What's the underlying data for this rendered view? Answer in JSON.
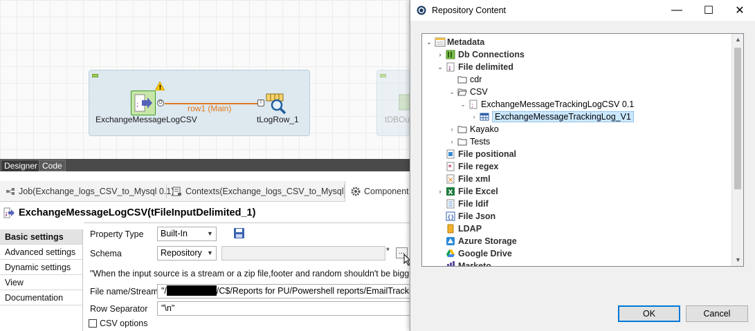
{
  "designer": {
    "nodes": {
      "input_label": "ExchangeMessageLogCSV",
      "output_label": "tLogRow_1",
      "faded_label": "tDBOu",
      "flow_label": "row1 (Main)"
    },
    "tabs": {
      "designer": "Designer",
      "code": "Code"
    }
  },
  "view_tabs": {
    "job": "Job(Exchange_logs_CSV_to_Mysql 0.1)",
    "contexts": "Contexts(Exchange_logs_CSV_to_Mysql)",
    "component": "Component"
  },
  "component_panel": {
    "title": "ExchangeMessageLogCSV(tFileInputDelimited_1)",
    "nav": [
      "Basic settings",
      "Advanced settings",
      "Dynamic settings",
      "View",
      "Documentation"
    ],
    "property_type": {
      "label": "Property Type",
      "value": "Built-In"
    },
    "schema": {
      "label": "Schema",
      "value": "Repository",
      "asterisk": "*",
      "browse": "..."
    },
    "note": "\"When the input source is a stream or a zip file,footer and random shouldn't be bigger th",
    "file_name": {
      "label": "File name/Stream",
      "prefix": "\"/",
      "suffix": "/C$/Reports for PU/Powershell reports/EmailTracking"
    },
    "row_separator": {
      "label": "Row Separator",
      "value": "\"\\n\""
    },
    "csv_options": {
      "label": "CSV options",
      "checked": false
    }
  },
  "dialog": {
    "title": "Repository Content",
    "minimize": "—",
    "maximize": "☐",
    "close": "✕",
    "tree": {
      "metadata": "Metadata",
      "db_connections": "Db Connections",
      "file_delimited": "File delimited",
      "cdr": "cdr",
      "csv": "CSV",
      "exchange_csv": "ExchangeMessageTrackingLogCSV 0.1",
      "exchange_schema": "ExchangeMessageTrackingLog_V1",
      "kayako": "Kayako",
      "tests": "Tests",
      "file_positional": "File positional",
      "file_regex": "File regex",
      "file_xml": "File xml",
      "file_excel": "File Excel",
      "file_ldif": "File ldif",
      "file_json": "File Json",
      "ldap": "LDAP",
      "azure": "Azure Storage",
      "gdrive": "Google Drive",
      "marketo": "Marketo"
    },
    "ok": "OK",
    "cancel": "Cancel"
  }
}
